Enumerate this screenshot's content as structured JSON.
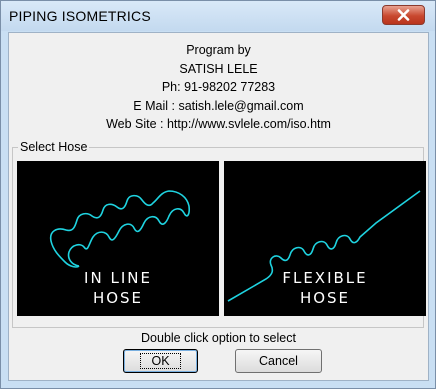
{
  "window": {
    "title": "PIPING ISOMETRICS"
  },
  "info": {
    "line1": "Program by",
    "line2": "SATISH LELE",
    "line3": "Ph: 91-98202 77283",
    "line4": "E Mail : satish.lele@gmail.com",
    "line5": "Web Site : http://www.svlele.com/iso.htm"
  },
  "group": {
    "label": "Select Hose",
    "options": [
      {
        "label_line1": "IN LINE",
        "label_line2": "HOSE",
        "icon": "inline-hose-icon"
      },
      {
        "label_line1": "FLEXIBLE",
        "label_line2": "HOSE",
        "icon": "flexible-hose-icon"
      }
    ]
  },
  "hint": "Double click option to select",
  "buttons": {
    "ok": "OK",
    "cancel": "Cancel"
  },
  "colors": {
    "hose_line": "#1fd3e0",
    "panel_bg": "#000000",
    "close_button": "#c8482f"
  }
}
